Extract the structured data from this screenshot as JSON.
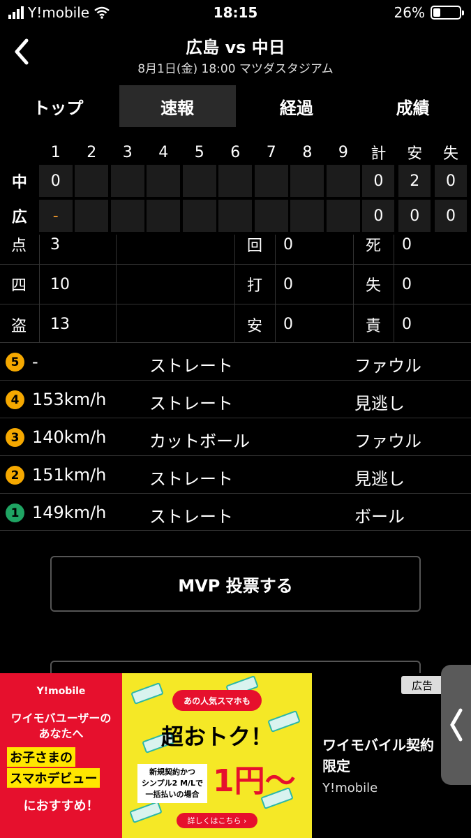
{
  "status": {
    "carrier": "Y!mobile",
    "time": "18:15",
    "battery": "26%"
  },
  "header": {
    "title": "広島 vs 中日",
    "subtitle": "8月1日(金) 18:00 マツダスタジアム"
  },
  "tabs": [
    "トップ",
    "速報",
    "経過",
    "成績"
  ],
  "scoreboard": {
    "innings": [
      "1",
      "2",
      "3",
      "4",
      "5",
      "6",
      "7",
      "8",
      "9"
    ],
    "totals_headers": [
      "計",
      "安",
      "失"
    ],
    "rows": [
      {
        "team": "中",
        "innings": [
          "0",
          "",
          "",
          "",
          "",
          "",
          "",
          "",
          ""
        ],
        "totals": [
          "0",
          "2",
          "0"
        ]
      },
      {
        "team": "広",
        "innings": [
          "-",
          "",
          "",
          "",
          "",
          "",
          "",
          "",
          ""
        ],
        "totals": [
          "0",
          "0",
          "0"
        ]
      }
    ]
  },
  "stats": [
    [
      {
        "label": "点",
        "value": "3"
      },
      {
        "label": "回",
        "value": "0"
      },
      {
        "label": "死",
        "value": "0"
      }
    ],
    [
      {
        "label": "四",
        "value": "10"
      },
      {
        "label": "打",
        "value": "0"
      },
      {
        "label": "失",
        "value": "0"
      }
    ],
    [
      {
        "label": "盗",
        "value": "13"
      },
      {
        "label": "安",
        "value": "0"
      },
      {
        "label": "責",
        "value": "0"
      }
    ]
  ],
  "pitches": [
    {
      "num": "5",
      "speed": "-",
      "type": "ストレート",
      "result": "ファウル",
      "color": "#f5a800"
    },
    {
      "num": "4",
      "speed": "153km/h",
      "type": "ストレート",
      "result": "見逃し",
      "color": "#f5a800"
    },
    {
      "num": "3",
      "speed": "140km/h",
      "type": "カットボール",
      "result": "ファウル",
      "color": "#f5a800"
    },
    {
      "num": "2",
      "speed": "151km/h",
      "type": "ストレート",
      "result": "見逃し",
      "color": "#f5a800"
    },
    {
      "num": "1",
      "speed": "149km/h",
      "type": "ストレート",
      "result": "ボール",
      "color": "#1fa463"
    }
  ],
  "mvp_button": "MVP 投票する",
  "ad": {
    "brand": "Y!mobile",
    "left_line1": "ワイモバユーザーの",
    "left_line2": "あなたへ",
    "highlight1": "お子さまの",
    "highlight2": "スマホデビュー",
    "recommend": "におすすめ！",
    "pill": "あの人気スマホも",
    "big": "超おトク！",
    "small1": "新規契約かつ",
    "small2": "シンプル2 M/Lで",
    "small3": "一括払いの場合",
    "price": "1円～",
    "more": "詳しくはこちら ›",
    "right_title": "ワイモバイル契約",
    "right_title2": "限定",
    "right_brand": "Y!mobile",
    "badge": "広告"
  }
}
